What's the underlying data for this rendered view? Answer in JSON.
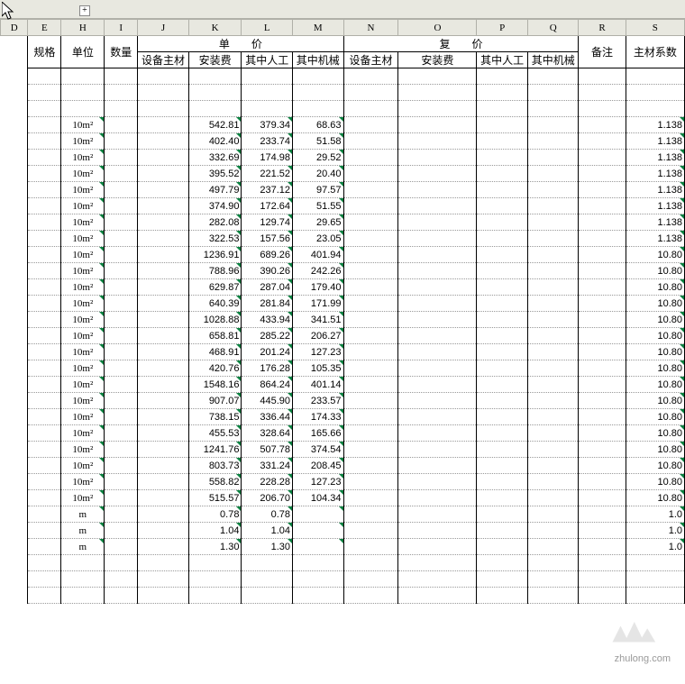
{
  "outline_toggle": "+",
  "col_letters": [
    "D",
    "E",
    "H",
    "I",
    "J",
    "K",
    "L",
    "M",
    "N",
    "O",
    "P",
    "Q",
    "R",
    "S"
  ],
  "headers": {
    "g1": "规格",
    "g2": "单位",
    "g3": "数量",
    "unit_price": "单　　价",
    "compound_price": "复　　价",
    "remark": "备注",
    "factor": "主材系数",
    "sub_j": "设备主材",
    "sub_k": "安装费",
    "sub_l": "其中人工",
    "sub_m": "其中机械",
    "sub_n": "设备主材",
    "sub_o": "安装费",
    "sub_p": "其中人工",
    "sub_q": "其中机械"
  },
  "rows": [
    {
      "unit": "10m²",
      "k": "542.81",
      "l": "379.34",
      "m": "68.63",
      "s": "1.138"
    },
    {
      "unit": "10m²",
      "k": "402.40",
      "l": "233.74",
      "m": "51.58",
      "s": "1.138"
    },
    {
      "unit": "10m²",
      "k": "332.69",
      "l": "174.98",
      "m": "29.52",
      "s": "1.138"
    },
    {
      "unit": "10m²",
      "k": "395.52",
      "l": "221.52",
      "m": "20.40",
      "s": "1.138"
    },
    {
      "unit": "10m²",
      "k": "497.79",
      "l": "237.12",
      "m": "97.57",
      "s": "1.138"
    },
    {
      "unit": "10m²",
      "k": "374.90",
      "l": "172.64",
      "m": "51.55",
      "s": "1.138"
    },
    {
      "unit": "10m²",
      "k": "282.08",
      "l": "129.74",
      "m": "29.65",
      "s": "1.138"
    },
    {
      "unit": "10m²",
      "k": "322.53",
      "l": "157.56",
      "m": "23.05",
      "s": "1.138"
    },
    {
      "unit": "10m²",
      "k": "1236.91",
      "l": "689.26",
      "m": "401.94",
      "s": "10.80"
    },
    {
      "unit": "10m²",
      "k": "788.96",
      "l": "390.26",
      "m": "242.26",
      "s": "10.80"
    },
    {
      "unit": "10m²",
      "k": "629.87",
      "l": "287.04",
      "m": "179.40",
      "s": "10.80"
    },
    {
      "unit": "10m²",
      "k": "640.39",
      "l": "281.84",
      "m": "171.99",
      "s": "10.80"
    },
    {
      "unit": "10m²",
      "k": "1028.88",
      "l": "433.94",
      "m": "341.51",
      "s": "10.80"
    },
    {
      "unit": "10m²",
      "k": "658.81",
      "l": "285.22",
      "m": "206.27",
      "s": "10.80"
    },
    {
      "unit": "10m²",
      "k": "468.91",
      "l": "201.24",
      "m": "127.23",
      "s": "10.80"
    },
    {
      "unit": "10m²",
      "k": "420.76",
      "l": "176.28",
      "m": "105.35",
      "s": "10.80"
    },
    {
      "unit": "10m²",
      "k": "1548.16",
      "l": "864.24",
      "m": "401.14",
      "s": "10.80"
    },
    {
      "unit": "10m²",
      "k": "907.07",
      "l": "445.90",
      "m": "233.57",
      "s": "10.80"
    },
    {
      "unit": "10m²",
      "k": "738.15",
      "l": "336.44",
      "m": "174.33",
      "s": "10.80"
    },
    {
      "unit": "10m²",
      "k": "455.53",
      "l": "328.64",
      "m": "165.66",
      "s": "10.80"
    },
    {
      "unit": "10m²",
      "k": "1241.76",
      "l": "507.78",
      "m": "374.54",
      "s": "10.80"
    },
    {
      "unit": "10m²",
      "k": "803.73",
      "l": "331.24",
      "m": "208.45",
      "s": "10.80"
    },
    {
      "unit": "10m²",
      "k": "558.82",
      "l": "228.28",
      "m": "127.23",
      "s": "10.80"
    },
    {
      "unit": "10m²",
      "k": "515.57",
      "l": "206.70",
      "m": "104.34",
      "s": "10.80"
    },
    {
      "unit": "m",
      "k": "0.78",
      "l": "0.78",
      "m": "",
      "s": "1.0"
    },
    {
      "unit": "m",
      "k": "1.04",
      "l": "1.04",
      "m": "",
      "s": "1.0"
    },
    {
      "unit": "m",
      "k": "1.30",
      "l": "1.30",
      "m": "",
      "s": "1.0"
    }
  ],
  "watermark": "zhulong.com"
}
